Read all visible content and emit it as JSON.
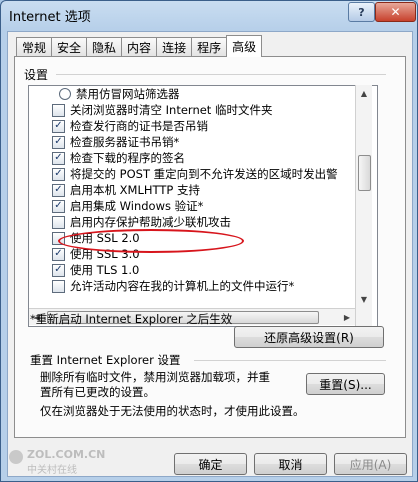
{
  "window": {
    "title": "Internet 选项",
    "help_label": "?",
    "close_label": "✕"
  },
  "tabs": [
    {
      "label": "常规",
      "active": false
    },
    {
      "label": "安全",
      "active": false
    },
    {
      "label": "隐私",
      "active": false
    },
    {
      "label": "内容",
      "active": false
    },
    {
      "label": "连接",
      "active": false
    },
    {
      "label": "程序",
      "active": false
    },
    {
      "label": "高级",
      "active": true
    }
  ],
  "settings": {
    "group_label": "设置",
    "items": [
      {
        "type": "radio",
        "checked": false,
        "label": "禁用仿冒网站筛选器"
      },
      {
        "type": "checkbox",
        "checked": false,
        "label": "关闭浏览器时清空 Internet 临时文件夹"
      },
      {
        "type": "checkbox",
        "checked": true,
        "label": "检查发行商的证书是否吊销"
      },
      {
        "type": "checkbox",
        "checked": true,
        "label": "检查服务器证书吊销*"
      },
      {
        "type": "checkbox",
        "checked": true,
        "label": "检查下载的程序的签名"
      },
      {
        "type": "checkbox",
        "checked": true,
        "label": "将提交的 POST 重定向到不允许发送的区域时发出警"
      },
      {
        "type": "checkbox",
        "checked": true,
        "label": "启用本机 XMLHTTP 支持"
      },
      {
        "type": "checkbox",
        "checked": true,
        "label": "启用集成 Windows 验证*"
      },
      {
        "type": "checkbox",
        "checked": false,
        "label": "启用内存保护帮助减少联机攻击"
      },
      {
        "type": "checkbox",
        "checked": false,
        "label": "使用 SSL 2.0"
      },
      {
        "type": "checkbox",
        "checked": true,
        "label": "使用 SSL 3.0"
      },
      {
        "type": "checkbox",
        "checked": true,
        "label": "使用 TLS 1.0"
      },
      {
        "type": "checkbox",
        "checked": false,
        "label": "允许活动内容在我的计算机上的文件中运行*"
      }
    ],
    "restart_note": "*重新启动 Internet Explorer 之后生效",
    "restore_button": "还原高级设置(R)"
  },
  "reset": {
    "group_label": "重置 Internet Explorer 设置",
    "description": "删除所有临时文件，禁用浏览器加载项，并重置所有已更改的设置。",
    "button": "重置(S)...",
    "note": "仅在浏览器处于无法使用的状态时，才使用此设置。"
  },
  "footer": {
    "ok": "确定",
    "cancel": "取消",
    "apply": "应用(A)"
  },
  "watermark": {
    "text": "ZOL.COM.CN",
    "sub": "中关村在线"
  },
  "colors": {
    "highlight_ellipse": "#d7151c",
    "title_bar": "#b6cfe9"
  }
}
